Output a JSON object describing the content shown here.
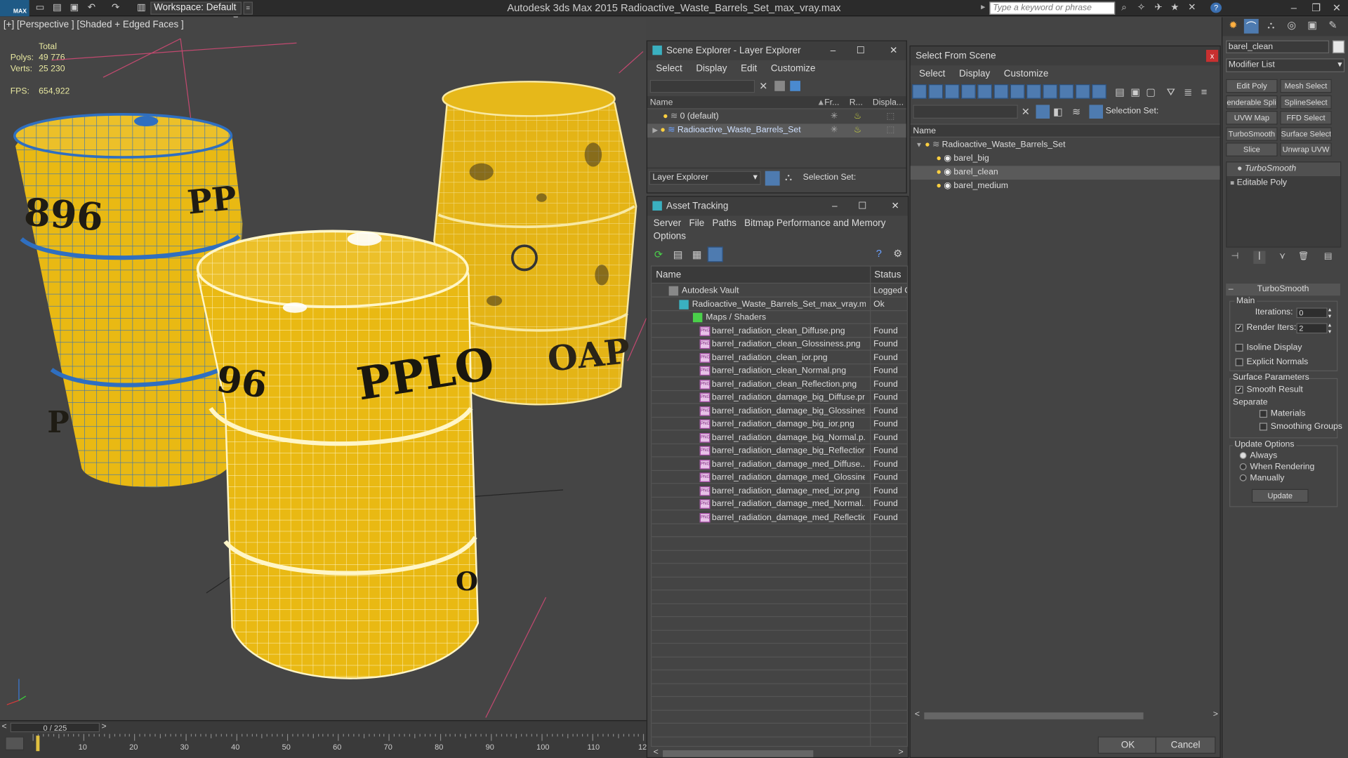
{
  "titlebar": {
    "logo": "MAX",
    "workspace": "Workspace: Default",
    "app_title": "Autodesk 3ds Max  2015      Radioactive_Waste_Barrels_Set_max_vray.max",
    "search_placeholder": "Type a keyword or phrase"
  },
  "viewport": {
    "label": "[+] [Perspective ] [Shaded + Edged Faces ]",
    "stats": {
      "total_label": "Total",
      "polys_label": "Polys:",
      "polys": "49 776",
      "verts_label": "Verts:",
      "verts": "25 230",
      "fps_label": "FPS:",
      "fps": "654,922"
    },
    "barrel_texts": [
      "896",
      "PPLO",
      "PPLO",
      "OAP",
      "96",
      "PP",
      "P",
      "O"
    ]
  },
  "timeline": {
    "slider": "0 / 225",
    "ticks": [
      "10",
      "20",
      "30",
      "40",
      "50",
      "60",
      "70",
      "80",
      "90",
      "100",
      "110",
      "12"
    ]
  },
  "scene_explorer": {
    "title": "Scene Explorer - Layer Explorer",
    "menu": [
      "Select",
      "Display",
      "Edit",
      "Customize"
    ],
    "columns": [
      "Name",
      "Fr...",
      "R...",
      "Displa..."
    ],
    "rows": [
      "0 (default)",
      "Radioactive_Waste_Barrels_Set"
    ],
    "footer_dropdown": "Layer Explorer",
    "selection_set": "Selection Set:"
  },
  "asset_tracking": {
    "title": "Asset Tracking",
    "menu": [
      "Server",
      "File",
      "Paths",
      "Bitmap Performance and Memory"
    ],
    "menu2": "Options",
    "columns": [
      "Name",
      "Status"
    ],
    "rows": [
      {
        "name": "Autodesk Vault",
        "status": "Logged O"
      },
      {
        "name": "Radioactive_Waste_Barrels_Set_max_vray.max",
        "status": "Ok"
      },
      {
        "name": "Maps / Shaders",
        "status": ""
      },
      {
        "name": "barrel_radiation_clean_Diffuse.png",
        "status": "Found"
      },
      {
        "name": "barrel_radiation_clean_Glossiness.png",
        "status": "Found"
      },
      {
        "name": "barrel_radiation_clean_ior.png",
        "status": "Found"
      },
      {
        "name": "barrel_radiation_clean_Normal.png",
        "status": "Found"
      },
      {
        "name": "barrel_radiation_clean_Reflection.png",
        "status": "Found"
      },
      {
        "name": "barrel_radiation_damage_big_Diffuse.png",
        "status": "Found"
      },
      {
        "name": "barrel_radiation_damage_big_Glossines...",
        "status": "Found"
      },
      {
        "name": "barrel_radiation_damage_big_ior.png",
        "status": "Found"
      },
      {
        "name": "barrel_radiation_damage_big_Normal.p...",
        "status": "Found"
      },
      {
        "name": "barrel_radiation_damage_big_Reflection...",
        "status": "Found"
      },
      {
        "name": "barrel_radiation_damage_med_Diffuse....",
        "status": "Found"
      },
      {
        "name": "barrel_radiation_damage_med_Glossine...",
        "status": "Found"
      },
      {
        "name": "barrel_radiation_damage_med_ior.png",
        "status": "Found"
      },
      {
        "name": "barrel_radiation_damage_med_Normal....",
        "status": "Found"
      },
      {
        "name": "barrel_radiation_damage_med_Reflectio...",
        "status": "Found"
      }
    ],
    "png_label": "PNG"
  },
  "select_from_scene": {
    "title": "Select From Scene",
    "menu": [
      "Select",
      "Display",
      "Customize"
    ],
    "selection_set": "Selection Set:",
    "column": "Name",
    "tree": [
      "Radioactive_Waste_Barrels_Set",
      "barel_big",
      "barel_clean",
      "barel_medium"
    ],
    "ok": "OK",
    "cancel": "Cancel"
  },
  "command_panel": {
    "object_name": "barel_clean",
    "modifier_list": "Modifier List",
    "buttons": [
      "Edit Poly",
      "Mesh Select",
      "enderable Splir",
      "SplineSelect",
      "UVW Map",
      "FFD Select",
      "TurboSmooth",
      "Surface Select",
      "Slice",
      "Unwrap UVW"
    ],
    "stack": [
      "TurboSmooth",
      "Editable Poly"
    ],
    "rollout_title": "TurboSmooth",
    "main_label": "Main",
    "iterations_label": "Iterations:",
    "iterations": "0",
    "render_iters_label": "Render Iters:",
    "render_iters": "2",
    "isoline": "Isoline Display",
    "explicit_normals": "Explicit Normals",
    "surface_params": "Surface Parameters",
    "smooth_result": "Smooth Result",
    "separate": "Separate",
    "materials": "Materials",
    "smoothing_groups": "Smoothing Groups",
    "update_options": "Update Options",
    "always": "Always",
    "when_rendering": "When Rendering",
    "manually": "Manually",
    "update": "Update"
  },
  "colors": {
    "barrel_yellow": "#e9b913",
    "wire_blue": "#2f6fc0",
    "wire_white": "#fff6c8",
    "selection_blue": "#3d6fb3"
  }
}
